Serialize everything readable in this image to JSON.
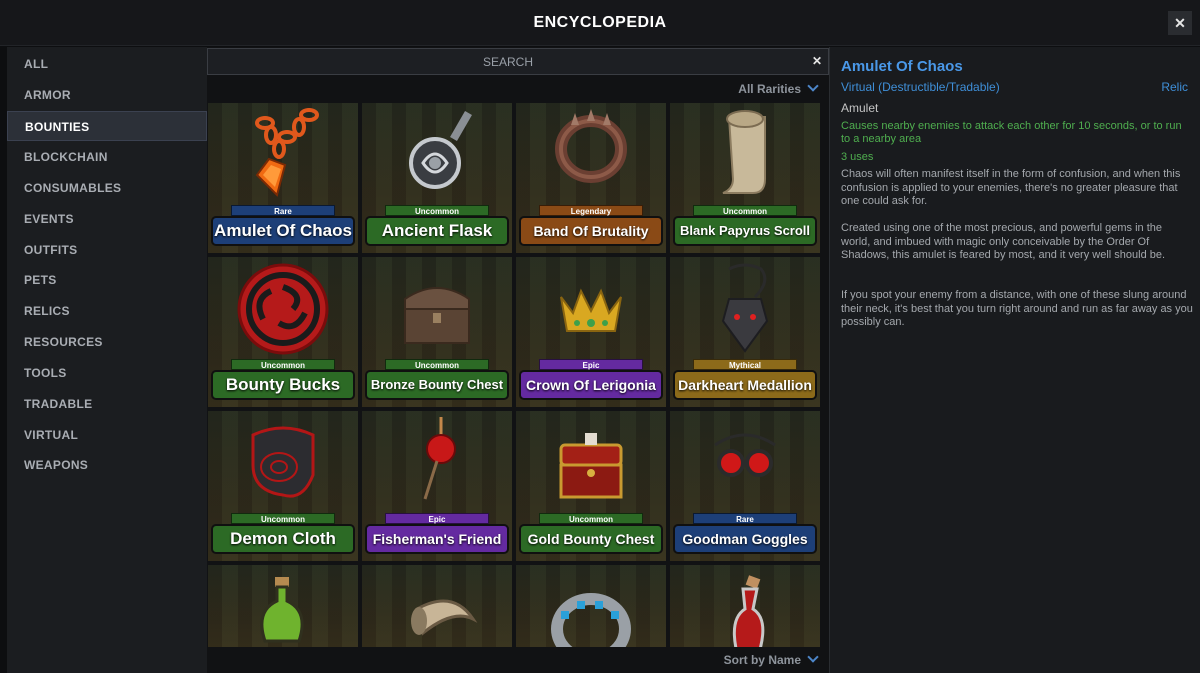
{
  "window": {
    "title": "ENCYCLOPEDIA",
    "close": "✕"
  },
  "sidebar": {
    "items": [
      {
        "label": "ALL"
      },
      {
        "label": "ARMOR"
      },
      {
        "label": "BOUNTIES"
      },
      {
        "label": "BLOCKCHAIN"
      },
      {
        "label": "CONSUMABLES"
      },
      {
        "label": "EVENTS"
      },
      {
        "label": "OUTFITS"
      },
      {
        "label": "PETS"
      },
      {
        "label": "RELICS"
      },
      {
        "label": "RESOURCES"
      },
      {
        "label": "TOOLS"
      },
      {
        "label": "TRADABLE"
      },
      {
        "label": "VIRTUAL"
      },
      {
        "label": "WEAPONS"
      }
    ],
    "selected": "BOUNTIES"
  },
  "search": {
    "placeholder": "SEARCH",
    "clear": "✕"
  },
  "filters": {
    "rarity": "All Rarities",
    "sort": "Sort by Name"
  },
  "rarity_colors": {
    "Rare": "#1d3f78",
    "Uncommon": "#2c6a25",
    "Legendary": "#8a4a16",
    "Epic": "#642aa0",
    "Mythical": "#8c6a1a"
  },
  "items": [
    {
      "name": "Amulet Of Chaos",
      "rarity": "Rare",
      "icon": "amulet-icon"
    },
    {
      "name": "Ancient Flask",
      "rarity": "Uncommon",
      "icon": "flask-icon"
    },
    {
      "name": "Band Of Brutality",
      "rarity": "Legendary",
      "icon": "spiked-band-icon"
    },
    {
      "name": "Blank Papyrus Scroll",
      "rarity": "Uncommon",
      "icon": "scroll-icon"
    },
    {
      "name": "Bounty Bucks",
      "rarity": "Uncommon",
      "icon": "bounty-bucks-icon"
    },
    {
      "name": "Bronze Bounty Chest",
      "rarity": "Uncommon",
      "icon": "chest-icon"
    },
    {
      "name": "Crown Of Lerigonia",
      "rarity": "Epic",
      "icon": "crown-icon"
    },
    {
      "name": "Darkheart Medallion",
      "rarity": "Mythical",
      "icon": "medallion-icon"
    },
    {
      "name": "Demon Cloth",
      "rarity": "Uncommon",
      "icon": "cloth-icon"
    },
    {
      "name": "Fisherman's Friend",
      "rarity": "Epic",
      "icon": "bobber-icon"
    },
    {
      "name": "Gold Bounty Chest",
      "rarity": "Uncommon",
      "icon": "gold-chest-icon"
    },
    {
      "name": "Goodman Goggles",
      "rarity": "Rare",
      "icon": "goggles-icon"
    },
    {
      "name": "",
      "rarity": "",
      "icon": "potion-icon"
    },
    {
      "name": "",
      "rarity": "",
      "icon": "horn-icon"
    },
    {
      "name": "",
      "rarity": "",
      "icon": "bracelet-icon"
    },
    {
      "name": "",
      "rarity": "",
      "icon": "vial-icon"
    }
  ],
  "detail": {
    "name": "Amulet Of Chaos",
    "subtype": "Virtual (Destructible/Tradable)",
    "category": "Relic",
    "type": "Amulet",
    "effect": "Causes nearby enemies to attack each other for 10 seconds, or to run to a nearby area",
    "uses": "3 uses",
    "paragraphs": [
      "Chaos will often manifest itself in the form of confusion, and when this confusion is applied to your enemies, there's no greater pleasure that one could ask for.",
      "Created using one of the most precious, and powerful gems in the world, and imbued with magic only conceivable by the Order Of Shadows, this amulet is feared by most, and it very well should be.",
      "If you spot your enemy from a distance, with one of these slung around their neck, it's best that you turn right around and run as far away as you possibly can."
    ]
  }
}
